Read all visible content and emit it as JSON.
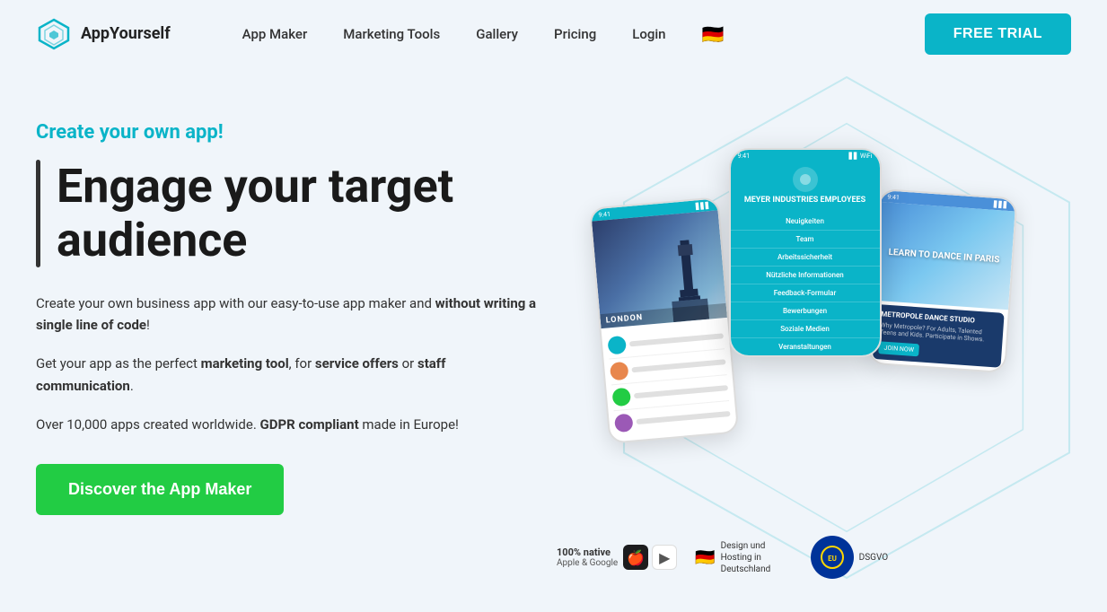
{
  "header": {
    "logo_text": "AppYourself",
    "nav_items": [
      {
        "label": "App Maker",
        "id": "app-maker"
      },
      {
        "label": "Marketing Tools",
        "id": "marketing-tools"
      },
      {
        "label": "Gallery",
        "id": "gallery"
      },
      {
        "label": "Pricing",
        "id": "pricing"
      },
      {
        "label": "Login",
        "id": "login"
      }
    ],
    "free_trial_label": "FREE TRIAL",
    "flag_emoji": "🇩🇪"
  },
  "hero": {
    "subtitle": "Create your own app!",
    "heading_line1": "Engage your target",
    "heading_line2": "audience",
    "body1_plain": "Create your own business app with our easy-to-use app maker and ",
    "body1_bold": "without writing a single line of code",
    "body1_end": "!",
    "body2_start": "Get your app as the perfect ",
    "body2_bold1": "marketing tool",
    "body2_mid": ", for ",
    "body2_bold2": "service offers",
    "body2_end": " or ",
    "body2_bold3": "staff communication",
    "body2_end2": ".",
    "body3_start": "Over 10,000 apps created worldwide. ",
    "body3_bold": "GDPR compliant",
    "body3_end": " made in Europe!",
    "cta_label": "Discover the App Maker"
  },
  "phones": {
    "center": {
      "status_time": "9:41",
      "brand_name": "MEYER INDUSTRIES EMPLOYEES",
      "menu_items": [
        "Neuigkeiten",
        "Team",
        "Arbeitssicherheit",
        "Nützliche Informationen",
        "Feedback-Formular",
        "Bewerbungen",
        "Soziale Medien",
        "Veranstaltungen"
      ]
    },
    "left": {
      "city": "LONDON"
    },
    "right": {
      "title": "LEARN TO DANCE IN PARIS",
      "card_title": "METROPOLE DANCE STUDIO",
      "card_sub": "Why Metropole? For Adults, Talented Teens and Kids. Participate in Shows.",
      "btn_label": "JOIN NOW"
    }
  },
  "badges": {
    "native_label": "100% native",
    "stores_label": "Apple & Google",
    "design_label": "Design und Hosting in Deutschland",
    "dsgvo_label": "DSGVO"
  }
}
